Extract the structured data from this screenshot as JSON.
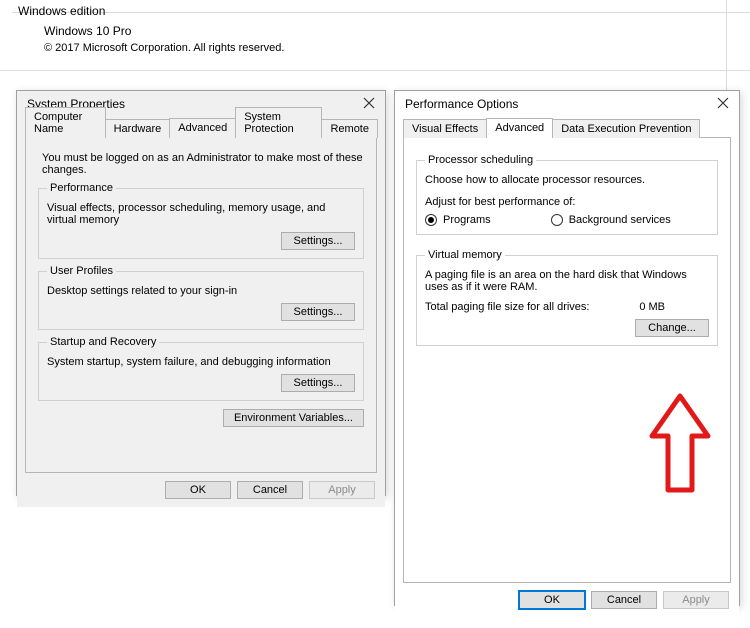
{
  "background": {
    "section_label": "Windows edition",
    "edition": "Windows 10 Pro",
    "copyright": "© 2017 Microsoft Corporation. All rights reserved."
  },
  "sys_dialog": {
    "title": "System Properties",
    "tabs": [
      "Computer Name",
      "Hardware",
      "Advanced",
      "System Protection",
      "Remote"
    ],
    "active_tab": "Advanced",
    "note": "You must be logged on as an Administrator to make most of these changes.",
    "groups": {
      "performance": {
        "legend": "Performance",
        "desc": "Visual effects, processor scheduling, memory usage, and virtual memory",
        "button": "Settings..."
      },
      "user_profiles": {
        "legend": "User Profiles",
        "desc": "Desktop settings related to your sign-in",
        "button": "Settings..."
      },
      "startup": {
        "legend": "Startup and Recovery",
        "desc": "System startup, system failure, and debugging information",
        "button": "Settings..."
      }
    },
    "env_vars_button": "Environment Variables...",
    "footer": {
      "ok": "OK",
      "cancel": "Cancel",
      "apply": "Apply"
    }
  },
  "perf_dialog": {
    "title": "Performance Options",
    "tabs": [
      "Visual Effects",
      "Advanced",
      "Data Execution Prevention"
    ],
    "active_tab": "Advanced",
    "processor": {
      "legend": "Processor scheduling",
      "desc": "Choose how to allocate processor resources.",
      "adjust_label": "Adjust for best performance of:",
      "programs": "Programs",
      "background": "Background services"
    },
    "virtual_memory": {
      "legend": "Virtual memory",
      "desc": "A paging file is an area on the hard disk that Windows uses as if it were RAM.",
      "total_label": "Total paging file size for all drives:",
      "total_value": "0 MB",
      "change_button": "Change..."
    },
    "footer": {
      "ok": "OK",
      "cancel": "Cancel",
      "apply": "Apply"
    }
  }
}
